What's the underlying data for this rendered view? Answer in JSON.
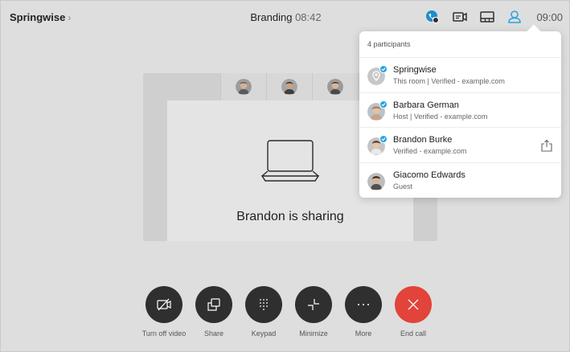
{
  "topbar": {
    "brand": "Springwise",
    "meeting_name": "Branding",
    "timer": "08:42",
    "clock": "09:00",
    "icons": [
      "call-status-icon",
      "camera-icon",
      "layout-icon",
      "participants-icon"
    ]
  },
  "stage": {
    "sharing_text": "Brandon is sharing"
  },
  "participants": {
    "count_label": "4 participants",
    "list": [
      {
        "name": "Springwise",
        "sub": "This room | Verified - example.com",
        "verified": true
      },
      {
        "name": "Barbara German",
        "sub": "Host | Verified - example.com",
        "verified": true
      },
      {
        "name": "Brandon Burke",
        "sub": "Verified - example.com",
        "verified": true
      },
      {
        "name": "Giacomo Edwards",
        "sub": "Guest",
        "verified": false
      }
    ]
  },
  "controls": [
    {
      "label": "Turn off video",
      "icon": "video-off-icon"
    },
    {
      "label": "Share",
      "icon": "share-screen-icon"
    },
    {
      "label": "Keypad",
      "icon": "keypad-icon"
    },
    {
      "label": "Minimize",
      "icon": "minimize-icon"
    },
    {
      "label": "More",
      "icon": "more-icon"
    },
    {
      "label": "End call",
      "icon": "end-call-icon"
    }
  ],
  "colors": {
    "accent": "#2aa4e0",
    "end_call": "#e2433a",
    "control_bg": "#2f2f2f"
  }
}
